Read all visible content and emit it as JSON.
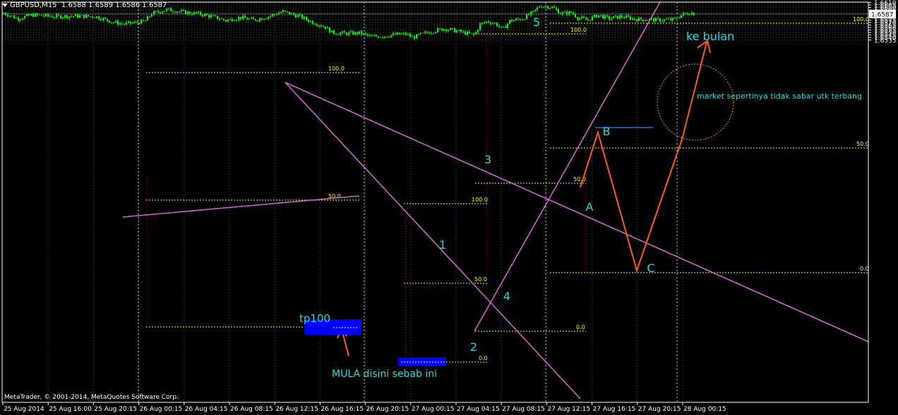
{
  "header": {
    "symbol": "GBPUSD,M15",
    "ohlc": "1.6588 1.6589 1.6586 1.6587"
  },
  "copyright": "MetaTrader, © 2001-2014, MetaQuotes Software Corp.",
  "colors": {
    "background": "#000000",
    "candle": "#00ff00",
    "grid": "#4a4a4a",
    "fib": "#ffff00",
    "trend": "#cc66cc",
    "wave": "#ff5a1f",
    "text_cyan": "#22dddd",
    "box": "#0000ff",
    "price_line": "#3a7fff"
  },
  "chart_data": {
    "type": "candlestick",
    "y_ticks": [
      "1.6610",
      "1.6605",
      "1.6600",
      "1.6595",
      "1.6590",
      "1.6585",
      "1.6580",
      "1.6575",
      "1.6570",
      "1.6565",
      "1.6560",
      "1.6555",
      "1.6550",
      "1.6545",
      "1.6540",
      "1.6535"
    ],
    "current_price": "1.6587",
    "x_ticks": [
      "25 Aug 2014",
      "25 Aug 16:00",
      "25 Aug 20:15",
      "26 Aug 00:15",
      "26 Aug 04:15",
      "26 Aug 08:15",
      "26 Aug 12:15",
      "26 Aug 16:15",
      "26 Aug 20:15",
      "27 Aug 00:15",
      "27 Aug 04:15",
      "27 Aug 08:15",
      "27 Aug 12:15",
      "27 Aug 16:15",
      "27 Aug 20:15",
      "28 Aug 00:15"
    ],
    "wave_labels": [
      "1",
      "2",
      "3",
      "4",
      "5",
      "A",
      "B",
      "C"
    ],
    "fib_labels": [
      "100.0",
      "50.0",
      "0.0"
    ],
    "annotations": {
      "tp": "tp100",
      "start": "MULA disini sebab ini",
      "target": "ke bulan",
      "note": "market sepertinya tidak sabar utk terbang"
    }
  }
}
